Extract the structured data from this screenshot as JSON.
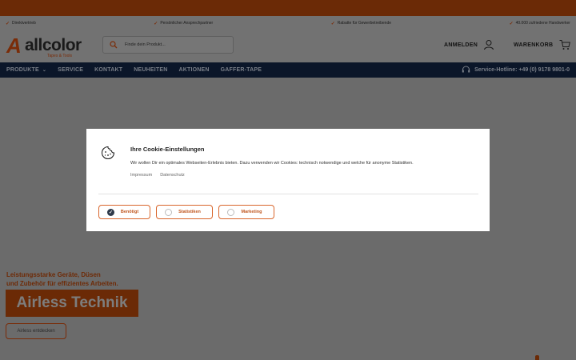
{
  "usp": [
    "Direktvertrieb",
    "Persönlicher Ansprechpartner",
    "Rabatte für Gewerbetreibende",
    "40.000 zufriedene Handwerker"
  ],
  "logo": {
    "name": "allcolor",
    "tagline": "Tapes & Tools"
  },
  "search": {
    "placeholder": "Finde dein Produkt..."
  },
  "header": {
    "login_label": "ANMELDEN",
    "cart_label": "WARENKORB"
  },
  "nav": {
    "items": [
      "PRODUKTE",
      "SERVICE",
      "KONTAKT",
      "NEUHEITEN",
      "AKTIONEN",
      "GAFFER-TAPE"
    ],
    "hotline": "Service-Hotline: +49 (0) 9178 9801-0"
  },
  "banner": {
    "line1": "Leistungsstarke Geräte, Düsen",
    "line2": "und Zubehör für effizientes Arbeiten.",
    "title": "Airless Technik",
    "button": "Airless entdecken"
  },
  "cookie": {
    "title": "Ihre Cookie-Einstellungen",
    "description": "Wir wollen Dir ein optimales Webseiten-Erlebnis bieten. Dazu verwenden wir Cookies: technisch notwendige und welche für anonyme Statistiken.",
    "links": [
      "Impressum",
      "Datenschutz"
    ],
    "options": [
      {
        "label": "Benötigt",
        "checked": true
      },
      {
        "label": "Statistiken",
        "checked": false
      },
      {
        "label": "Marketing",
        "checked": false
      }
    ]
  },
  "colors": {
    "brand_orange": "#d9662c",
    "nav_bg": "#0b1629",
    "top_band": "#6b2a06"
  }
}
